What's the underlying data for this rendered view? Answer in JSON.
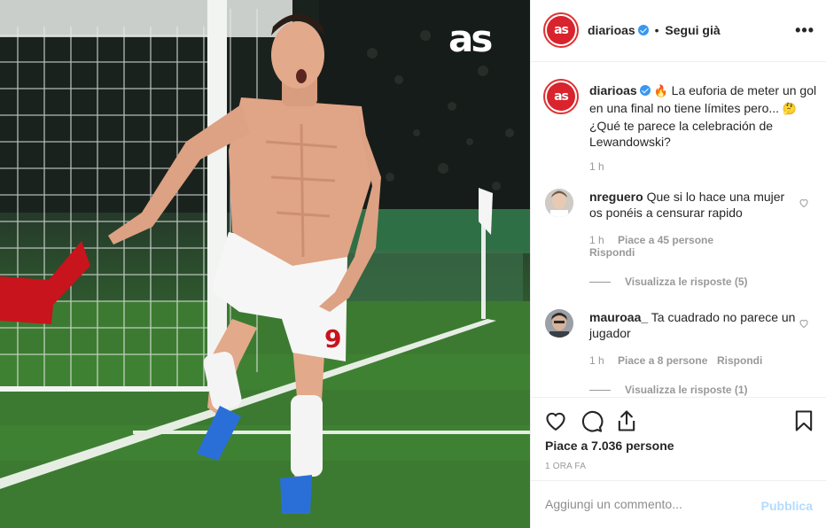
{
  "photo": {
    "logo_text": "as",
    "jersey_number": "9"
  },
  "header": {
    "username": "diarioas",
    "separator": "•",
    "follow_label": "Segui già",
    "more_glyph": "•••"
  },
  "caption": {
    "username": "diarioas",
    "emoji1": "🔥",
    "text1": "La euforia de meter un gol en una final no tiene límites pero...",
    "emoji2": "🤔",
    "text2": "¿Qué te parece la celebración de Lewandowski?",
    "time": "1 h"
  },
  "comments": [
    {
      "username": "nreguero",
      "text": "Que si lo hace una mujer os ponéis a censurar rapido",
      "time": "1 h",
      "likes": "Piace a 45 persone",
      "reply": "Rispondi",
      "view_replies": "Visualizza le risposte (5)"
    },
    {
      "username": "mauroaa_",
      "text": "Ta cuadrado no parece un jugador",
      "time": "1 h",
      "likes": "Piace a 8 persone",
      "reply": "Rispondi",
      "view_replies": "Visualizza le risposte (1)"
    }
  ],
  "actions": {
    "likes_text": "Piace a 7.036 persone",
    "time_ago": "1 ORA FA"
  },
  "add_comment": {
    "placeholder": "Aggiungi un commento...",
    "publish_label": "Pubblica"
  },
  "colors": {
    "verified": "#3897f0",
    "brand_red": "#d9232d",
    "publish_disabled": "#b3dbff"
  }
}
